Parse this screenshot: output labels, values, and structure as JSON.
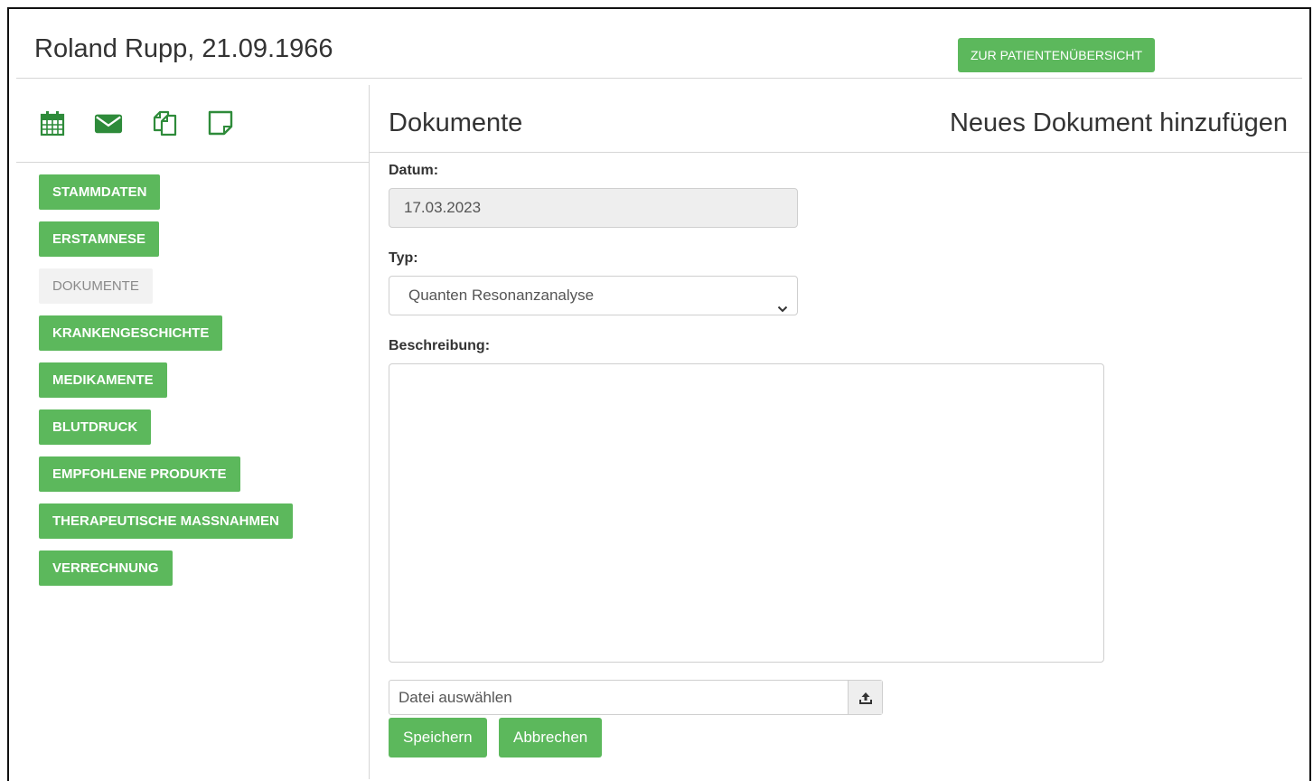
{
  "header": {
    "patient": "Roland Rupp, 21.09.1966",
    "overview_button": "ZUR PATIENTENÜBERSICHT"
  },
  "toolbar_icons": [
    "calendar-icon",
    "envelope-icon",
    "copy-icon",
    "note-icon"
  ],
  "sidebar": {
    "items": [
      {
        "label": "STAMMDATEN",
        "active": true
      },
      {
        "label": "ERSTAMNESE",
        "active": true
      },
      {
        "label": "DOKUMENTE",
        "active": false
      },
      {
        "label": "KRANKENGESCHICHTE",
        "active": true
      },
      {
        "label": "MEDIKAMENTE",
        "active": true
      },
      {
        "label": "BLUTDRUCK",
        "active": true
      },
      {
        "label": "EMPFOHLENE PRODUKTE",
        "active": true
      },
      {
        "label": "THERAPEUTISCHE MASSNAHMEN",
        "active": true
      },
      {
        "label": "VERRECHNUNG",
        "active": true
      }
    ]
  },
  "main": {
    "title": "Dokumente",
    "subtitle": "Neues Dokument hinzufügen",
    "date_label": "Datum:",
    "date_value": "17.03.2023",
    "type_label": "Typ:",
    "type_value": "Quanten Resonanzanalyse",
    "description_label": "Beschreibung:",
    "description_value": "",
    "file_placeholder": "Datei auswählen",
    "save_button": "Speichern",
    "cancel_button": "Abbrechen"
  },
  "colors": {
    "accent": "#5cb85c",
    "inactive_bg": "#f2f2f2",
    "border": "#d6d6d6"
  }
}
